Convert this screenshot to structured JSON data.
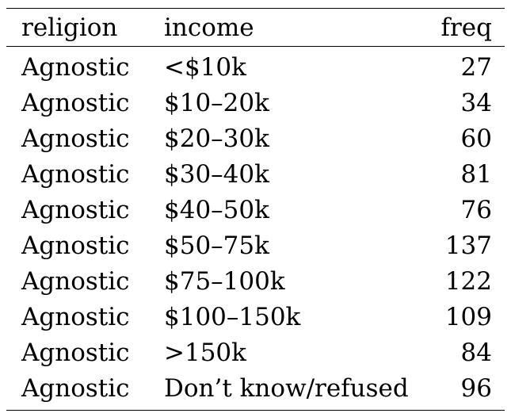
{
  "table": {
    "headers": {
      "religion": "religion",
      "income": "income",
      "freq": "freq"
    },
    "rows": [
      {
        "religion": "Agnostic",
        "income": "<$10k",
        "freq": "27"
      },
      {
        "religion": "Agnostic",
        "income": "$10–20k",
        "freq": "34"
      },
      {
        "religion": "Agnostic",
        "income": "$20–30k",
        "freq": "60"
      },
      {
        "religion": "Agnostic",
        "income": "$30–40k",
        "freq": "81"
      },
      {
        "religion": "Agnostic",
        "income": "$40–50k",
        "freq": "76"
      },
      {
        "religion": "Agnostic",
        "income": "$50–75k",
        "freq": "137"
      },
      {
        "religion": "Agnostic",
        "income": "$75–100k",
        "freq": "122"
      },
      {
        "religion": "Agnostic",
        "income": "$100–150k",
        "freq": "109"
      },
      {
        "religion": "Agnostic",
        "income": ">150k",
        "freq": "84"
      },
      {
        "religion": "Agnostic",
        "income": "Don’t know/refused",
        "freq": "96"
      }
    ]
  }
}
